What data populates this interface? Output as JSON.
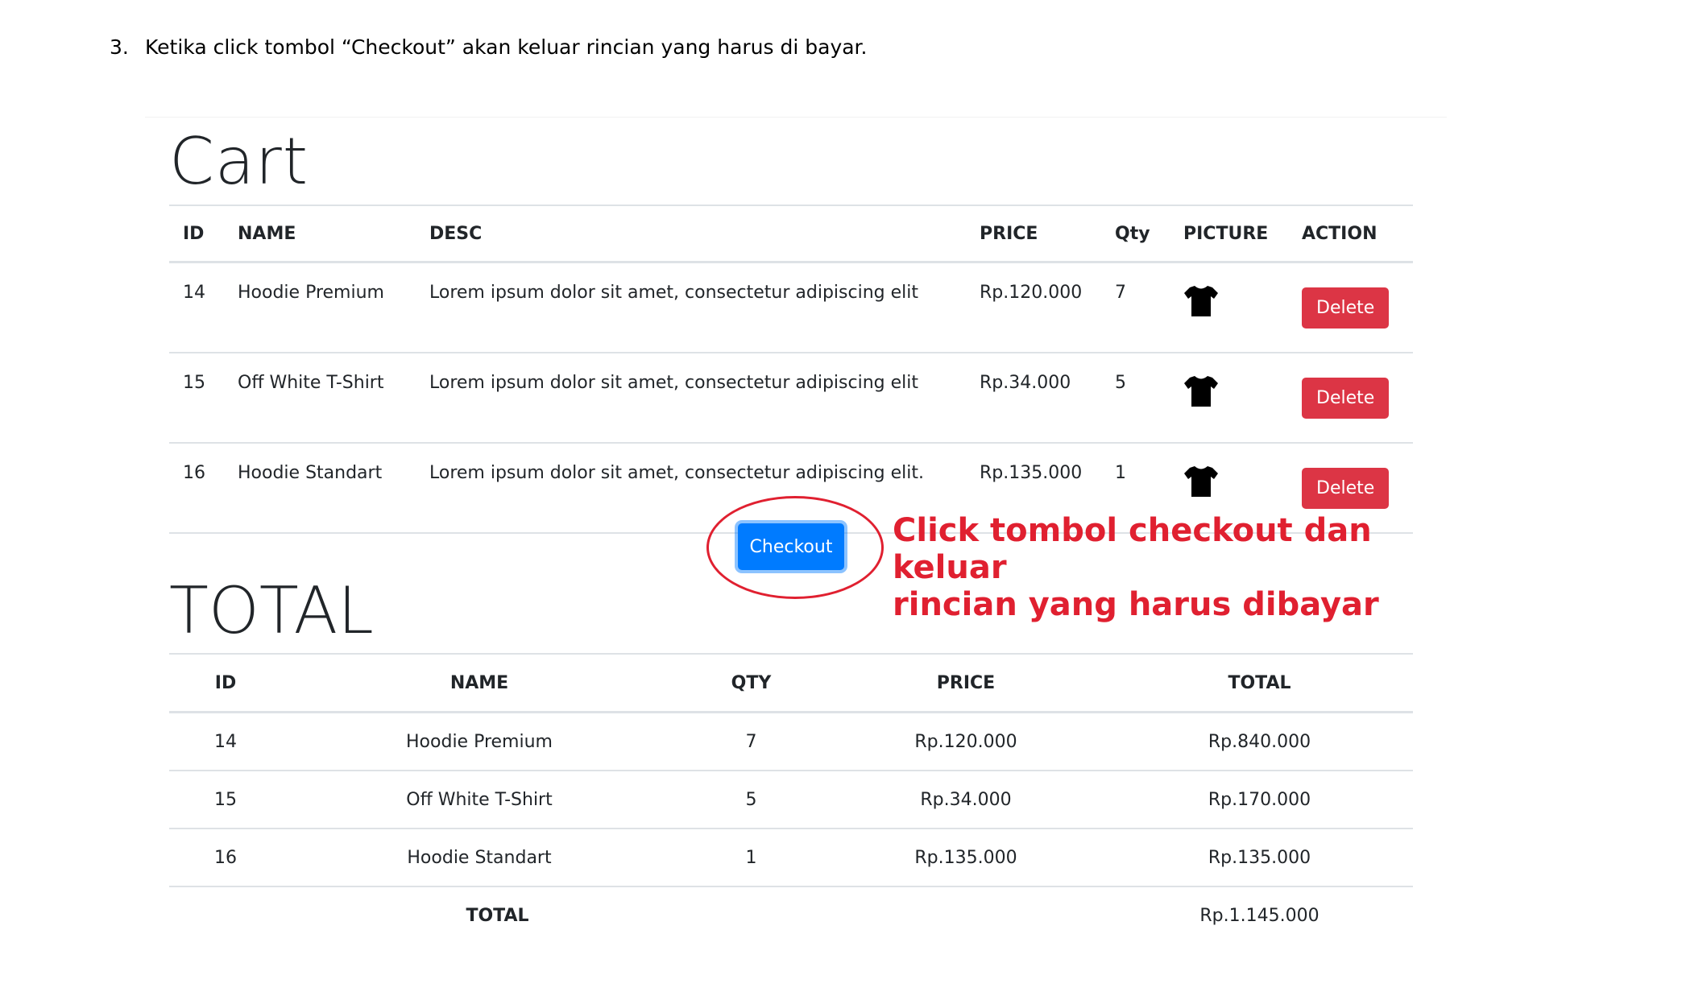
{
  "doc": {
    "step_number": "3.",
    "step_text": "Ketika click tombol “Checkout” akan keluar rincian yang harus di bayar."
  },
  "cart": {
    "title": "Cart",
    "headers": [
      "ID",
      "NAME",
      "DESC",
      "PRICE",
      "Qty",
      "PICTURE",
      "ACTION"
    ],
    "rows": [
      {
        "id": "14",
        "name": "Hoodie Premium",
        "desc": "Lorem ipsum dolor sit amet, consectetur adipiscing elit",
        "price": "Rp.120.000",
        "qty": "7",
        "picture": "tshirt-icon",
        "action": "Delete"
      },
      {
        "id": "15",
        "name": "Off White T-Shirt",
        "desc": "Lorem ipsum dolor sit amet, consectetur adipiscing elit",
        "price": "Rp.34.000",
        "qty": "5",
        "picture": "tshirt-icon",
        "action": "Delete"
      },
      {
        "id": "16",
        "name": "Hoodie Standart",
        "desc": "Lorem ipsum dolor sit amet, consectetur adipiscing elit.",
        "price": "Rp.135.000",
        "qty": "1",
        "picture": "tshirt-icon",
        "action": "Delete"
      }
    ]
  },
  "checkout": {
    "label": "Checkout",
    "annotation_line1": "Click tombol checkout dan keluar",
    "annotation_line2": "rincian yang harus dibayar",
    "annotation_color": "#e02030"
  },
  "total": {
    "title": "TOTAL",
    "headers": [
      "ID",
      "NAME",
      "QTY",
      "PRICE",
      "TOTAL"
    ],
    "rows": [
      {
        "id": "14",
        "name": "Hoodie Premium",
        "qty": "7",
        "price": "Rp.120.000",
        "total": "Rp.840.000"
      },
      {
        "id": "15",
        "name": "Off White T-Shirt",
        "qty": "5",
        "price": "Rp.34.000",
        "total": "Rp.170.000"
      },
      {
        "id": "16",
        "name": "Hoodie Standart",
        "qty": "1",
        "price": "Rp.135.000",
        "total": "Rp.135.000"
      }
    ],
    "sum_label": "TOTAL",
    "sum_value": "Rp.1.145.000"
  },
  "colors": {
    "delete": "#dc3545",
    "checkout": "#007bff",
    "border": "#dee2e6"
  }
}
